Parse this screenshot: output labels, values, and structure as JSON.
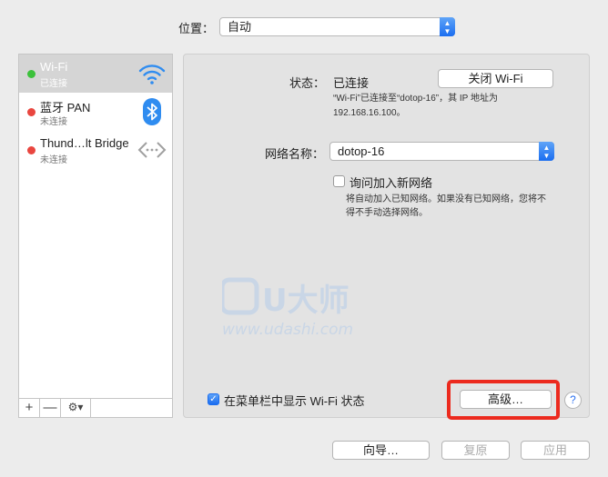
{
  "location": {
    "label": "位置：",
    "value": "自动"
  },
  "sidebar": {
    "items": [
      {
        "name": "Wi-Fi",
        "status": "已连接",
        "dot": "#3cc13b",
        "icon": "wifi-icon",
        "selected": true
      },
      {
        "name": "蓝牙 PAN",
        "status": "未连接",
        "dot": "#e9463f",
        "icon": "bluetooth-icon",
        "selected": false
      },
      {
        "name": "Thund…lt Bridge",
        "status": "未连接",
        "dot": "#e9463f",
        "icon": "thunderbolt-bridge-icon",
        "selected": false
      }
    ],
    "add_label": "+",
    "remove_label": "—",
    "action_label": "⚙▾"
  },
  "panel": {
    "status_label": "状态：",
    "status_value": "已连接",
    "toggle_button": "关闭 Wi-Fi",
    "status_desc_1": "“Wi-Fi”已连接至“dotop-16”，其 IP 地址为",
    "status_desc_2": "192.168.16.100。",
    "network_label": "网络名称：",
    "network_value": "dotop-16",
    "ask_join_label": "询问加入新网络",
    "ask_join_desc_1": "将自动加入已知网络。如果没有已知网络，您将不",
    "ask_join_desc_2": "得不手动选择网络。",
    "show_menu_label": "在菜单栏中显示 Wi-Fi 状态",
    "advanced_button": "高级…",
    "help_label": "?"
  },
  "watermark": {
    "logo": "U大师",
    "url": "www.udashi.com"
  },
  "footer": {
    "assistant_button": "向导…",
    "revert_button": "复原",
    "apply_button": "应用"
  },
  "colors": {
    "accent": "#1a6df0",
    "highlight": "#ec2a1e",
    "selected_row": "#d5d5d5"
  }
}
